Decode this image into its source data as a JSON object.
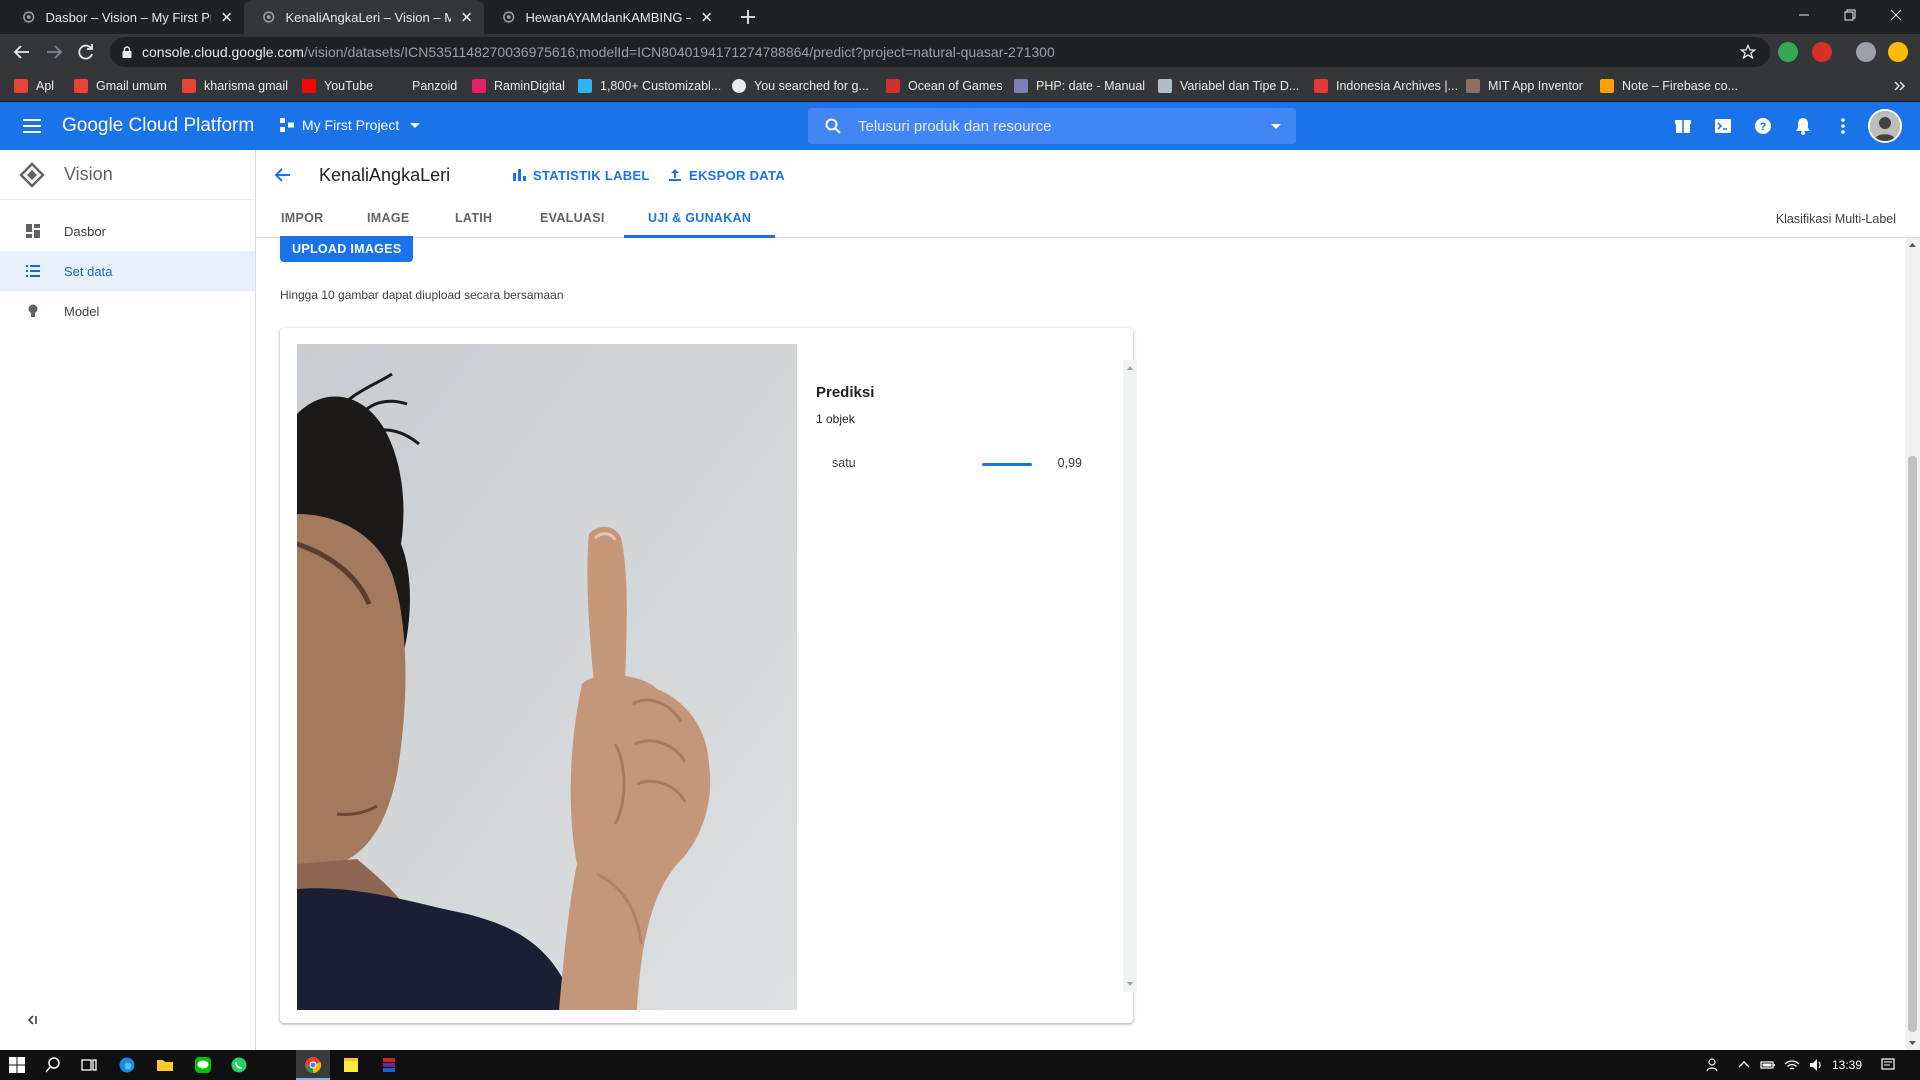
{
  "browser": {
    "tabs": [
      {
        "title": "Dasbor – Vision – My First Project",
        "active": false
      },
      {
        "title": "KenaliAngkaLeri – Vision – My First Project",
        "active": true
      },
      {
        "title": "HewanAYAMdanKAMBING – Vision – My First Project",
        "active": false
      }
    ],
    "url_host": "console.cloud.google.com",
    "url_path": "/vision/datasets/ICN5351148270036975616;modelId=ICN8040194171274788864/predict?project=natural-quasar-271300",
    "bookmarks": [
      {
        "label": "Apl",
        "icon": "apps-grid-icon",
        "color": "#ea4335"
      },
      {
        "label": "Gmail umum",
        "icon": "gmail-icon",
        "color": "#ea4335"
      },
      {
        "label": "kharisma gmail",
        "icon": "gmail-icon",
        "color": "#ea4335"
      },
      {
        "label": "YouTube",
        "icon": "youtube-icon",
        "color": "#ff0000"
      },
      {
        "label": "Panzoid",
        "icon": "panzoid-icon",
        "color": "#35363a"
      },
      {
        "label": "RaminDigital",
        "icon": "ramin-icon",
        "color": "#e91e63"
      },
      {
        "label": "1,800+ Customizabl...",
        "icon": "customizable-icon",
        "color": "#29b6f6"
      },
      {
        "label": "You searched for g...",
        "icon": "globe-icon",
        "color": "#e8eaed"
      },
      {
        "label": "Ocean of Games",
        "icon": "ocean-games-icon",
        "color": "#d32f2f"
      },
      {
        "label": "PHP: date - Manual",
        "icon": "php-icon",
        "color": "#7b7fb5"
      },
      {
        "label": "Variabel dan Tipe D...",
        "icon": "variabel-icon",
        "color": "#b0bec5"
      },
      {
        "label": "Indonesia Archives |...",
        "icon": "indonesia-archives-icon",
        "color": "#e53935"
      },
      {
        "label": "MIT App Inventor",
        "icon": "mit-app-inventor-icon",
        "color": "#8d6e63"
      },
      {
        "label": "Note – Firebase co...",
        "icon": "firebase-icon",
        "color": "#ffa000"
      }
    ]
  },
  "gcp": {
    "brand": "Google Cloud Platform",
    "project": "My First Project",
    "search_placeholder": "Telusuri produk dan resource"
  },
  "sidebar": {
    "title": "Vision",
    "items": [
      {
        "label": "Dasbor",
        "icon": "dashboard-icon",
        "active": false
      },
      {
        "label": "Set data",
        "icon": "list-icon",
        "active": true
      },
      {
        "label": "Model",
        "icon": "lightbulb-icon",
        "active": false
      }
    ]
  },
  "main": {
    "dataset_name": "KenaliAngkaLeri",
    "label_stats": "STATISTIK LABEL",
    "export_data": "EKSPOR DATA",
    "tabs": [
      {
        "label": "IMPOR",
        "active": false
      },
      {
        "label": "IMAGE",
        "active": false
      },
      {
        "label": "LATIH",
        "active": false
      },
      {
        "label": "EVALUASI",
        "active": false
      },
      {
        "label": "UJI & GUNAKAN",
        "active": true
      }
    ],
    "mode": "Klasifikasi Multi-Label",
    "upload_label": "UPLOAD IMAGES",
    "upload_hint": "Hingga 10 gambar dapat diupload secara bersamaan",
    "prediction": {
      "title": "Prediksi",
      "count": "1 objek",
      "results": [
        {
          "label": "satu",
          "score": 0.99,
          "score_text": "0,99"
        }
      ]
    }
  },
  "taskbar": {
    "time": "13:39"
  },
  "colors": {
    "gcp_blue": "#1a73e8",
    "chrome_dark": "#202124",
    "chrome_toolbar": "#35363a"
  }
}
